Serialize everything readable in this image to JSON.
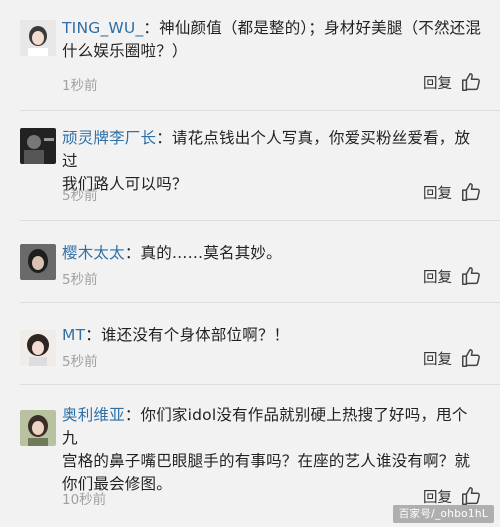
{
  "comments": [
    {
      "author": "TING_WU_",
      "text_lines": [
        "神仙颜值（都是整的）；身材好美腿（不然还混",
        "什么娱乐圈啦？）"
      ],
      "time": "1秒前",
      "reply_label": "回复"
    },
    {
      "author": "顽灵牌李厂长",
      "text_lines": [
        "请花点钱出个人写真，你爱买粉丝爱看，放过",
        "我们路人可以吗？"
      ],
      "time": "5秒前",
      "reply_label": "回复"
    },
    {
      "author": "樱木太太",
      "text_lines": [
        "真的……莫名其妙。"
      ],
      "time": "5秒前",
      "reply_label": "回复"
    },
    {
      "author": "MT",
      "text_lines": [
        "谁还没有个身体部位啊？！"
      ],
      "time": "5秒前",
      "reply_label": "回复"
    },
    {
      "author": "奥利维亚",
      "text_lines": [
        "你们家idol没有作品就别硬上热搜了好吗，甩个九",
        "宫格的鼻子嘴巴眼腿手的有事吗？在座的艺人谁没有啊？就",
        "你们最会修图。"
      ],
      "time": "10秒前",
      "reply_label": "回复"
    }
  ],
  "separator": "：",
  "icons": {
    "like": "thumbs-up-icon"
  },
  "watermark": "百家号/_ohbo1hL",
  "colors": {
    "author": "#2f6fa5",
    "text": "#222222",
    "time": "#a0a0a0",
    "background": "#f2f2f2",
    "divider": "#dedede"
  }
}
